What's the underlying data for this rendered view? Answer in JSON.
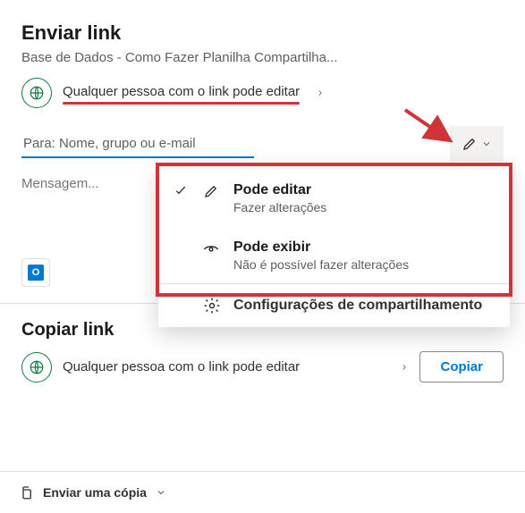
{
  "header": {
    "title": "Enviar link",
    "subtitle": "Base de Dados - Como Fazer Planilha Compartilha..."
  },
  "permission": {
    "link_text": "Qualquer pessoa com o link pode editar"
  },
  "recipients": {
    "placeholder": "Para: Nome, grupo ou e-mail"
  },
  "message": {
    "placeholder": "Mensagem..."
  },
  "menu": {
    "edit": {
      "label": "Pode editar",
      "desc": "Fazer alterações"
    },
    "view": {
      "label": "Pode exibir",
      "desc": "Não é possível fazer alterações"
    },
    "settings": "Configurações de compartilhamento"
  },
  "copy": {
    "title": "Copiar link",
    "text": "Qualquer pessoa com o link pode editar",
    "button": "Copiar"
  },
  "footer": {
    "send_copy": "Enviar uma cópia"
  }
}
